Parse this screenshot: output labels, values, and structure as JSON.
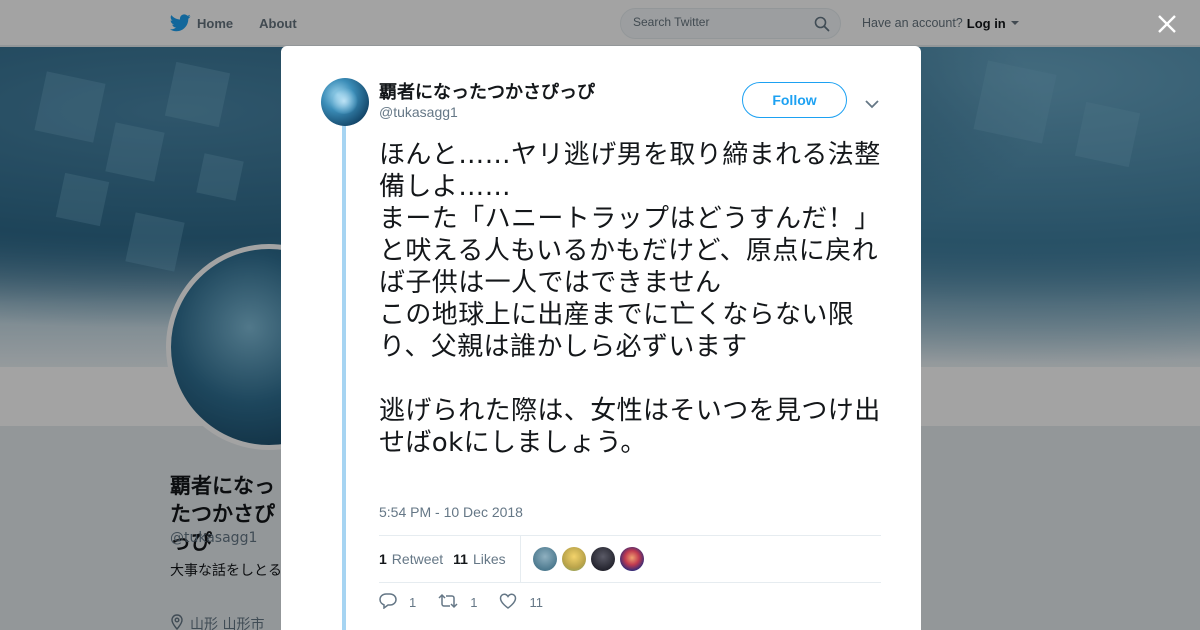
{
  "nav": {
    "home_label": "Home",
    "about_label": "About",
    "search_placeholder": "Search Twitter",
    "account_prompt": "Have an account?",
    "login_label": "Log in"
  },
  "profile": {
    "name": "覇者になったつかさぴっぴ",
    "handle": "@tukasagg1",
    "bio": "大事な話をしとるマンミサンドリス",
    "location": "山形 山形市"
  },
  "tweet": {
    "author_name": "覇者になったつかさぴっぴ",
    "author_handle": "@tukasagg1",
    "follow_label": "Follow",
    "text": "ほんと……ヤリ逃げ男を取り締まれる法整備しよ……\nまーた「ハニートラップはどうすんだ！」と吠える人もいるかもだけど、原点に戻れば子供は一人ではできません\nこの地球上に出産までに亡くならない限り、父親は誰かしら必ずいます\n\n逃げられた際は、女性はそいつを見つけ出せばokにしましょう。",
    "timestamp": "5:54 PM - 10 Dec 2018",
    "retweet_count": "1",
    "retweet_label": "Retweet",
    "like_count": "11",
    "like_label": "Likes",
    "reply_action_count": "1",
    "retweet_action_count": "1",
    "like_action_count": "11"
  },
  "colors": {
    "accent": "#1da1f2",
    "thread_line": "#a6d4f2"
  },
  "icons": [
    "twitter-bird-icon",
    "search-icon",
    "close-icon",
    "chevron-down-icon",
    "reply-icon",
    "retweet-icon",
    "heart-icon",
    "location-pin-icon"
  ]
}
